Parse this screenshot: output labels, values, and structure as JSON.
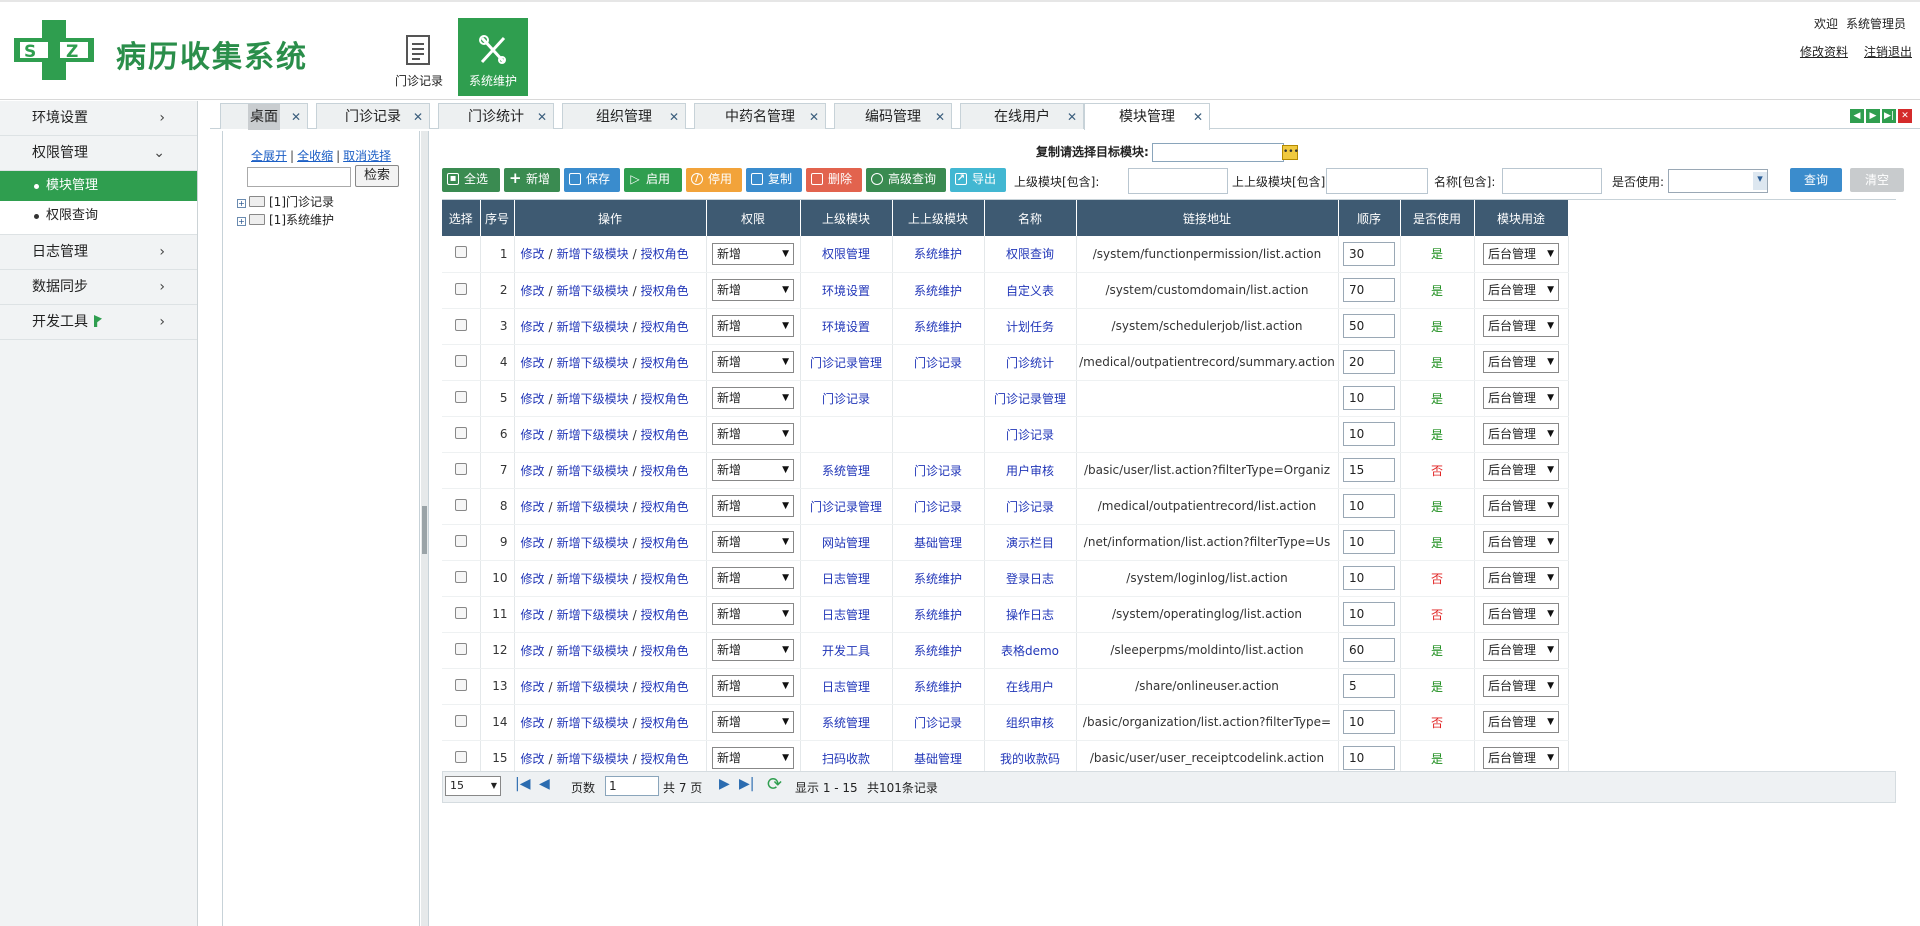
{
  "header": {
    "logo_text": "SZ",
    "title": "病历收集系统",
    "modules": [
      {
        "label": "门诊记录"
      },
      {
        "label": "系统维护"
      }
    ],
    "welcome": "欢迎",
    "username": "系统管理员",
    "links": {
      "edit_profile": "修改资料",
      "logout": "注销退出"
    }
  },
  "sidebar": {
    "items": [
      {
        "label": "环境设置",
        "chevron": ">"
      },
      {
        "label": "权限管理",
        "chevron": "v"
      },
      {
        "label": "日志管理",
        "chevron": ">"
      },
      {
        "label": "数据同步",
        "chevron": ">"
      },
      {
        "label": "开发工具",
        "chevron": ">"
      }
    ],
    "subitems": [
      {
        "label": "模块管理",
        "active": true
      },
      {
        "label": "权限查询",
        "active": false
      }
    ]
  },
  "tabs": [
    {
      "label": "桌面"
    },
    {
      "label": "门诊记录"
    },
    {
      "label": "门诊统计"
    },
    {
      "label": "组织管理"
    },
    {
      "label": "中药名管理"
    },
    {
      "label": "编码管理"
    },
    {
      "label": "在线用户"
    },
    {
      "label": "模块管理",
      "active": true
    }
  ],
  "tree": {
    "expand_all": "全展开",
    "collapse_all": "全收缩",
    "cancel_select": "取消选择",
    "search_button": "检索",
    "nodes": [
      {
        "label": "[1]门诊记录"
      },
      {
        "label": "[1]系统维护"
      }
    ]
  },
  "main": {
    "copy_label": "复制请选择目标模块:",
    "toolbar": {
      "select_all": "全选",
      "add": "新增",
      "save": "保存",
      "enable": "启用",
      "disable": "停用",
      "copy": "复制",
      "delete": "删除",
      "advanced": "高级查询",
      "export": "导出"
    },
    "filters": {
      "parent_label": "上级模块[包含]:",
      "grandparent_label": "上上级模块[包含]:",
      "name_label": "名称[包含]:",
      "in_use_label": "是否使用:",
      "query": "查询",
      "clear": "清空"
    },
    "columns": [
      "选择",
      "序号",
      "操作",
      "权限",
      "上级模块",
      "上上级模块",
      "名称",
      "链接地址",
      "顺序",
      "是否使用",
      "模块用途"
    ],
    "op_labels": {
      "edit": "修改",
      "add_child": "新增下级模块",
      "grant": "授权角色",
      "sep": "/"
    },
    "rows": [
      {
        "no": "1",
        "perm": "新增",
        "parent": "权限管理",
        "grand": "系统维护",
        "name": "权限查询",
        "url": "/system/functionpermission/list.action",
        "order": "30",
        "used": "是",
        "purpose": "后台管理"
      },
      {
        "no": "2",
        "perm": "新增",
        "parent": "环境设置",
        "grand": "系统维护",
        "name": "自定义表",
        "url": "/system/customdomain/list.action",
        "order": "70",
        "used": "是",
        "purpose": "后台管理"
      },
      {
        "no": "3",
        "perm": "新增",
        "parent": "环境设置",
        "grand": "系统维护",
        "name": "计划任务",
        "url": "/system/schedulerjob/list.action",
        "order": "50",
        "used": "是",
        "purpose": "后台管理"
      },
      {
        "no": "4",
        "perm": "新增",
        "parent": "门诊记录管理",
        "grand": "门诊记录",
        "name": "门诊统计",
        "url": "/medical/outpatientrecord/summary.action",
        "order": "20",
        "used": "是",
        "purpose": "后台管理"
      },
      {
        "no": "5",
        "perm": "新增",
        "parent": "门诊记录",
        "grand": "",
        "name": "门诊记录管理",
        "url": "",
        "order": "10",
        "used": "是",
        "purpose": "后台管理"
      },
      {
        "no": "6",
        "perm": "新增",
        "parent": "",
        "grand": "",
        "name": "门诊记录",
        "url": "",
        "order": "10",
        "used": "是",
        "purpose": "后台管理"
      },
      {
        "no": "7",
        "perm": "新增",
        "parent": "系统管理",
        "grand": "门诊记录",
        "name": "用户审核",
        "url": "/basic/user/list.action?filterType=Organiz",
        "order": "15",
        "used": "否",
        "purpose": "后台管理"
      },
      {
        "no": "8",
        "perm": "新增",
        "parent": "门诊记录管理",
        "grand": "门诊记录",
        "name": "门诊记录",
        "url": "/medical/outpatientrecord/list.action",
        "order": "10",
        "used": "是",
        "purpose": "后台管理"
      },
      {
        "no": "9",
        "perm": "新增",
        "parent": "网站管理",
        "grand": "基础管理",
        "name": "演示栏目",
        "url": "/net/information/list.action?filterType=Us",
        "order": "10",
        "used": "是",
        "purpose": "后台管理"
      },
      {
        "no": "10",
        "perm": "新增",
        "parent": "日志管理",
        "grand": "系统维护",
        "name": "登录日志",
        "url": "/system/loginlog/list.action",
        "order": "10",
        "used": "否",
        "purpose": "后台管理"
      },
      {
        "no": "11",
        "perm": "新增",
        "parent": "日志管理",
        "grand": "系统维护",
        "name": "操作日志",
        "url": "/system/operatinglog/list.action",
        "order": "10",
        "used": "否",
        "purpose": "后台管理"
      },
      {
        "no": "12",
        "perm": "新增",
        "parent": "开发工具",
        "grand": "系统维护",
        "name": "表格demo",
        "url": "/sleeperpms/moldinto/list.action",
        "order": "60",
        "used": "是",
        "purpose": "后台管理"
      },
      {
        "no": "13",
        "perm": "新增",
        "parent": "日志管理",
        "grand": "系统维护",
        "name": "在线用户",
        "url": "/share/onlineuser.action",
        "order": "5",
        "used": "是",
        "purpose": "后台管理"
      },
      {
        "no": "14",
        "perm": "新增",
        "parent": "系统管理",
        "grand": "门诊记录",
        "name": "组织审核",
        "url": "/basic/organization/list.action?filterType=",
        "order": "10",
        "used": "否",
        "purpose": "后台管理"
      },
      {
        "no": "15",
        "perm": "新增",
        "parent": "扫码收款",
        "grand": "基础管理",
        "name": "我的收款码",
        "url": "/basic/user/user_receiptcodelink.action",
        "order": "10",
        "used": "是",
        "purpose": "后台管理"
      }
    ]
  },
  "pager": {
    "page_size": "15",
    "page_label": "页数",
    "current_page": "1",
    "total_pages": "共 7 页",
    "display": "显示 1 - 15",
    "total_records": "共101条记录"
  },
  "colors": {
    "brand": "#2f9e4f",
    "header_row": "#3e5a72",
    "link": "#2136b8"
  }
}
